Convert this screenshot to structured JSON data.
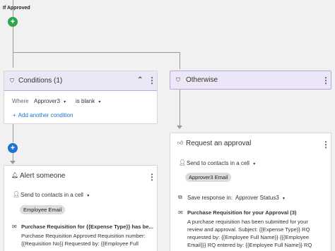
{
  "flow": {
    "branch_label": "If Approved",
    "add_symbol": "+",
    "add_color_top": "#2ea44f",
    "add_color_mid": "#1f72d3"
  },
  "conditions": {
    "title": "Conditions (1)",
    "where_label": "Where",
    "field_value": "Approver3",
    "operator_value": "is blank",
    "add_condition_label": "Add another condition",
    "header_bg": "#ece7f6"
  },
  "otherwise": {
    "title": "Otherwise"
  },
  "alert": {
    "title": "Alert someone",
    "send_to_label": "Send to contacts in a cell",
    "recipient_chip": "Employee Email",
    "message_title": "Purchase Requisition for {{Expense Type}} has be...",
    "message_body_1": "Purchase Requisition Approved Requisition number:",
    "message_body_2": "{{Requisition No}} Requested by: {{Employee Full"
  },
  "approval": {
    "title": "Request an approval",
    "send_to_label": "Send to contacts in a cell",
    "recipient_chip": "Approver3 Email",
    "save_response_label": "Save response in:",
    "save_response_value": "Approver Status3",
    "message_title": "Purchase Requisition for your Approval (3)",
    "message_body_1": "A purchase requisition has been submitted for your",
    "message_body_2": "review and approval. Subject: {{Expense Type}} RQ",
    "message_body_3": "requested by: {{Employee Full Name}} {{{Employee",
    "message_body_4": "Email}}} RQ entered by: {{Employee Full Name}} RQ"
  }
}
